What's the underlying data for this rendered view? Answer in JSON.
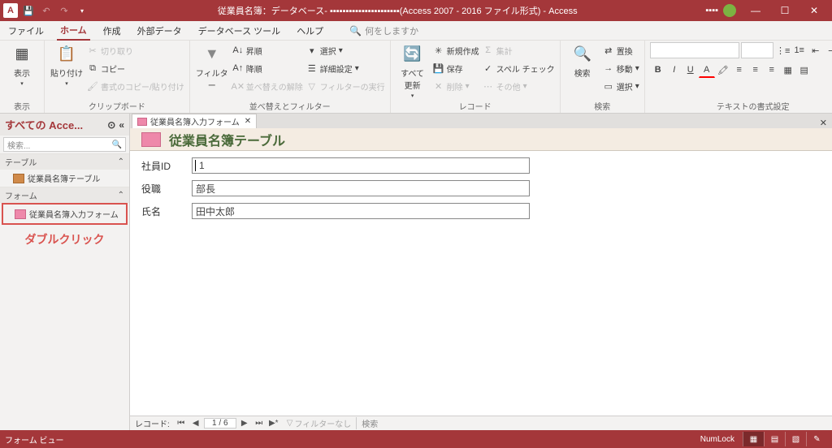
{
  "titlebar": {
    "app_icon": "A",
    "title": "従業員名簿：データベース- ▪▪▪▪▪▪▪▪▪▪▪▪▪▪▪▪▪▪▪▪▪▪(Access 2007 - 2016 ファイル形式)  -  Access",
    "username": "▪▪▪▪"
  },
  "menu": {
    "file": "ファイル",
    "home": "ホーム",
    "create": "作成",
    "external": "外部データ",
    "dbtools": "データベース ツール",
    "help": "ヘルプ",
    "tell_me": "何をしますか"
  },
  "ribbon": {
    "view": {
      "label": "表示",
      "btn": "表示"
    },
    "clipboard": {
      "label": "クリップボード",
      "paste": "貼り付け",
      "cut": "切り取り",
      "copy": "コピー",
      "fmtp": "書式のコピー/貼り付け"
    },
    "sort": {
      "label": "並べ替えとフィルター",
      "filter": "フィルター",
      "asc": "昇順",
      "desc": "降順",
      "remove": "並べ替えの解除",
      "sel": "選択",
      "adv": "詳細設定",
      "toggle": "フィルターの実行"
    },
    "records": {
      "label": "レコード",
      "refresh": "すべて\n更新",
      "new": "新規作成",
      "save": "保存",
      "delete": "削除",
      "totals": "集計",
      "spell": "スペル チェック",
      "more": "その他"
    },
    "find": {
      "label": "検索",
      "find": "検索",
      "replace": "置換",
      "goto": "移動",
      "select": "選択"
    },
    "fmt": {
      "label": "テキストの書式設定"
    }
  },
  "nav": {
    "title": "すべての Acce...",
    "search": "検索...",
    "tables": "テーブル",
    "table_item": "従業員名簿テーブル",
    "forms": "フォーム",
    "form_item": "従業員名簿入力フォーム",
    "annotation": "ダブルクリック"
  },
  "worktab": {
    "label": "従業員名簿入力フォーム"
  },
  "form": {
    "header": "従業員名簿テーブル",
    "f1_label": "社員ID",
    "f1_value": "1",
    "f2_label": "役職",
    "f2_value": "部長",
    "f3_label": "氏名",
    "f3_value": "田中太郎"
  },
  "recnav": {
    "label": "レコード:",
    "pos": "1 / 6",
    "filter": "フィルターなし",
    "search": "検索"
  },
  "status": {
    "mode": "フォーム ビュー",
    "numlock": "NumLock"
  }
}
